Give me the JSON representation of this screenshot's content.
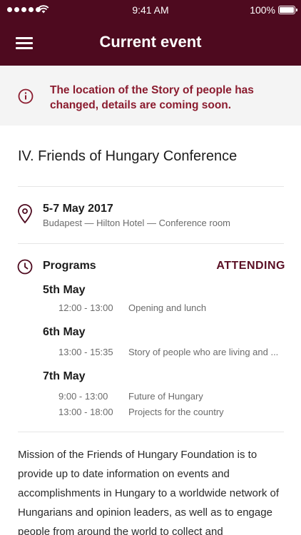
{
  "status_bar": {
    "time": "9:41 AM",
    "battery": "100%"
  },
  "header": {
    "title": "Current event"
  },
  "alert": {
    "message": "The location of the Story of people has changed, details are coming soon."
  },
  "event": {
    "title": "IV. Friends of Hungary Conference",
    "date": "5-7 May 2017",
    "location": "Budapest — Hilton Hotel — Conference room"
  },
  "programs": {
    "label": "Programs",
    "action": "ATTENDING",
    "days": [
      {
        "day": "5th May",
        "slots": [
          {
            "time": "12:00 - 13:00",
            "title": "Opening and lunch"
          }
        ]
      },
      {
        "day": "6th May",
        "slots": [
          {
            "time": "13:00 - 15:35",
            "title": "Story of people who are living and ..."
          }
        ]
      },
      {
        "day": "7th May",
        "slots": [
          {
            "time": "9:00 - 13:00",
            "title": "Future of Hungary"
          },
          {
            "time": "13:00 - 18:00",
            "title": "Projects for the country"
          }
        ]
      }
    ]
  },
  "description": "Mission of the Friends of Hungary Foundation is to provide up to date information on events and accomplishments in Hungary to a worldwide network of Hungarians and opinion leaders, as well as to engage people from around the world to collect and",
  "colors": {
    "primary": "#4e0a1f",
    "alert_text": "#8b1c2f",
    "alert_bg": "#f4f4f4"
  }
}
